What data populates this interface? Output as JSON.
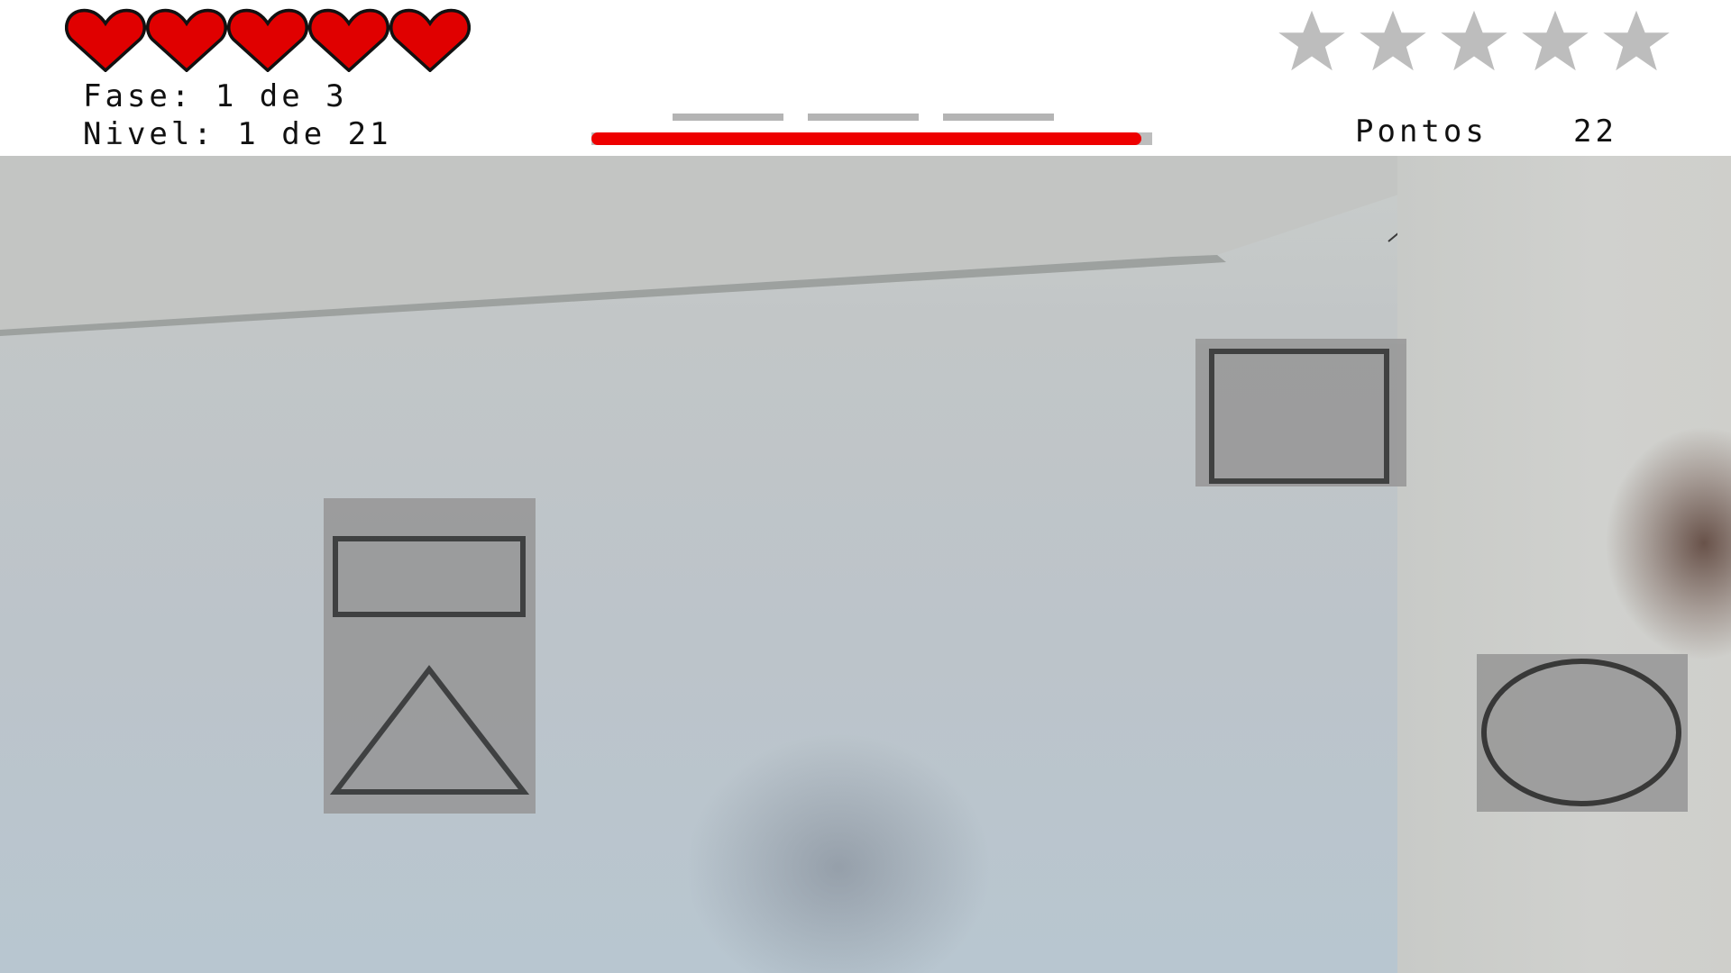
{
  "hud": {
    "lives": {
      "total": 5,
      "remaining": 5,
      "icon": "heart-icon",
      "color": "#e00000"
    },
    "phase_text": "Fase: 1 de 3",
    "level_text": "Nivel: 1 de 21",
    "rating": {
      "total": 5,
      "filled": 0,
      "icon": "star-icon",
      "empty_color": "#bdbdbd"
    },
    "points_label": "Pontos",
    "points_value": "22",
    "stages": {
      "total": 3
    },
    "timer": {
      "fraction_remaining": 0.98,
      "color": "#ee0000",
      "track_color": "#bdbdbd"
    }
  },
  "targets": [
    {
      "shapes": [
        "rectangle-icon",
        "triangle-icon"
      ]
    },
    {
      "shapes": [
        "square-icon"
      ]
    },
    {
      "shapes": [
        "ellipse-icon"
      ]
    }
  ],
  "colors": {
    "outline": "#2a2a2a",
    "target_bg": "#969696"
  }
}
